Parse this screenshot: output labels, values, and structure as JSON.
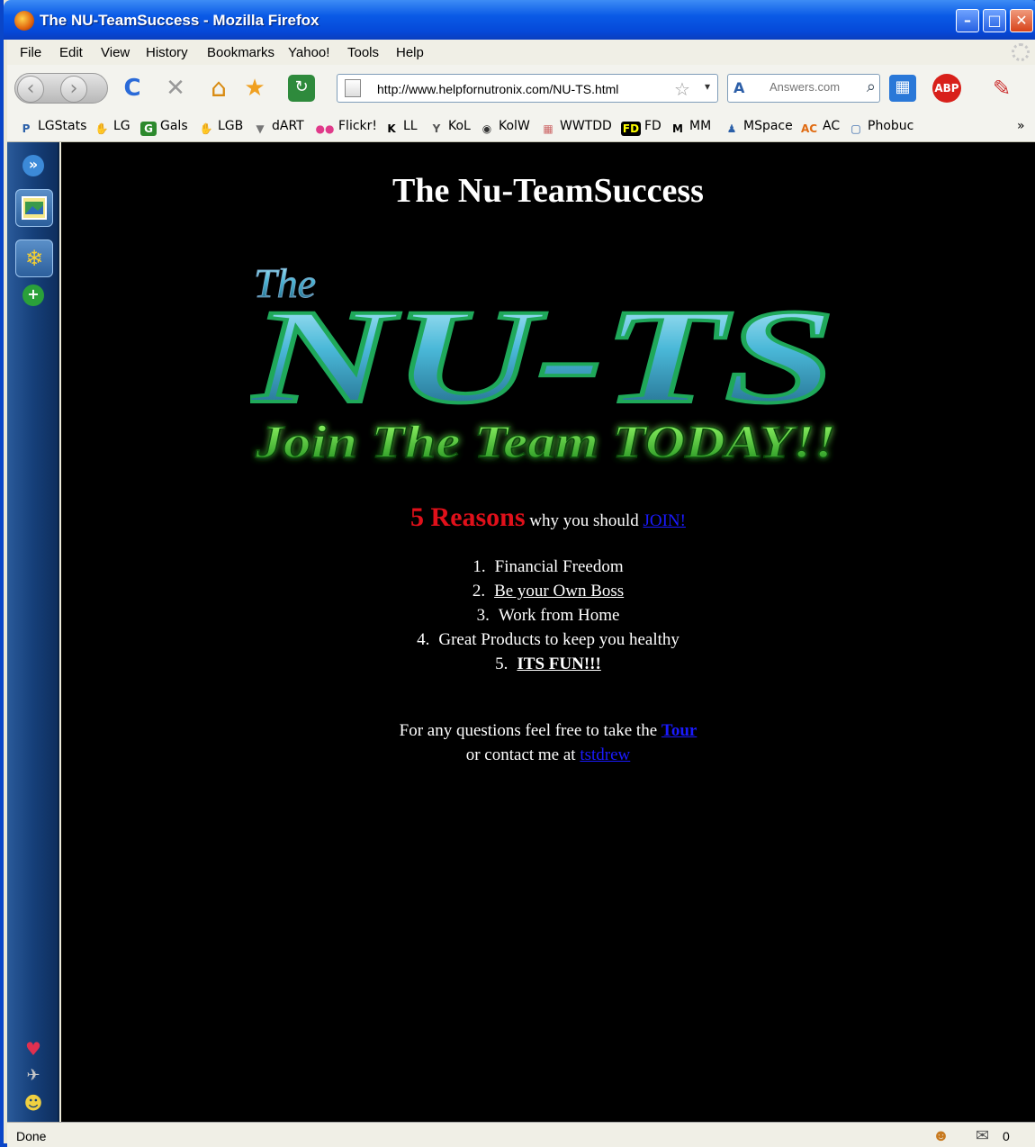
{
  "window": {
    "title": "The NU-TeamSuccess - Mozilla Firefox",
    "buttons": {
      "minimize": "–",
      "maximize": "□",
      "close": "✕"
    }
  },
  "menu": [
    "File",
    "Edit",
    "View",
    "History",
    "Bookmarks",
    "Yahoo!",
    "Tools",
    "Help"
  ],
  "toolbar": {
    "back_icon": "‹",
    "forward_icon": "›",
    "reload_icon": "C",
    "stop_icon": "✕",
    "home_icon": "⌂",
    "url": "http://www.helpfornutronix.com/NU-TS.html",
    "bookmark_star": "☆",
    "url_dropdown": "▾",
    "search_engine": "A",
    "search_placeholder": "Answers.com",
    "search_icon": "⌕"
  },
  "bookmarks": [
    {
      "label": "LGStats",
      "icon": "P",
      "color": "#2a5fa8"
    },
    {
      "label": "LG",
      "icon": "✋",
      "color": "#888"
    },
    {
      "label": "Gals",
      "icon": "G",
      "color": "#2d8a2d"
    },
    {
      "label": "LGB",
      "icon": "✋",
      "color": "#888"
    },
    {
      "label": "dART",
      "icon": "▼",
      "color": "#777"
    },
    {
      "label": "Flickr!",
      "icon": "●●",
      "color": "#e03a8a"
    },
    {
      "label": "LL",
      "icon": "K",
      "color": "#000"
    },
    {
      "label": "KoL",
      "icon": "Y",
      "color": "#555"
    },
    {
      "label": "KolW",
      "icon": "◉",
      "color": "#333"
    },
    {
      "label": "WWTDD",
      "icon": "▦",
      "color": "#c66"
    },
    {
      "label": "FD",
      "icon": "FD",
      "color": "#000"
    },
    {
      "label": "MM",
      "icon": "M",
      "color": "#000"
    },
    {
      "label": "MSpace",
      "icon": "♟",
      "color": "#2a5fa8"
    },
    {
      "label": "AC",
      "icon": "AC",
      "color": "#e06a10"
    },
    {
      "label": "Phobuc",
      "icon": "▢",
      "color": "#2a5fa8"
    }
  ],
  "bookmarks_overflow": "»",
  "sidebar": {
    "top_icon": "»",
    "add_icon": "+",
    "bottom_icons": [
      "♥",
      "✈",
      "☻"
    ]
  },
  "page": {
    "title": "The Nu-TeamSuccess",
    "logo": {
      "the": "The",
      "main": "NU-TS",
      "tagline": "Join The Team TODAY!!"
    },
    "reasons_heading": {
      "big": "5 Reasons",
      "rest": " why you should ",
      "link": "JOIN!"
    },
    "reasons": [
      {
        "num": "1.",
        "text": "Financial Freedom"
      },
      {
        "num": "2.",
        "text": "Be your Own Boss"
      },
      {
        "num": "3.",
        "text": "Work from Home"
      },
      {
        "num": "4.",
        "text": "Great Products to keep you healthy"
      },
      {
        "num": "5.",
        "text": "ITS FUN!!!"
      }
    ],
    "contact": {
      "line1": "For any questions feel free to take the ",
      "tour_link": "Tour",
      "line2": "or contact me at ",
      "email_link": "tstdrew"
    }
  },
  "status": {
    "text": "Done",
    "mail_count": "0"
  }
}
